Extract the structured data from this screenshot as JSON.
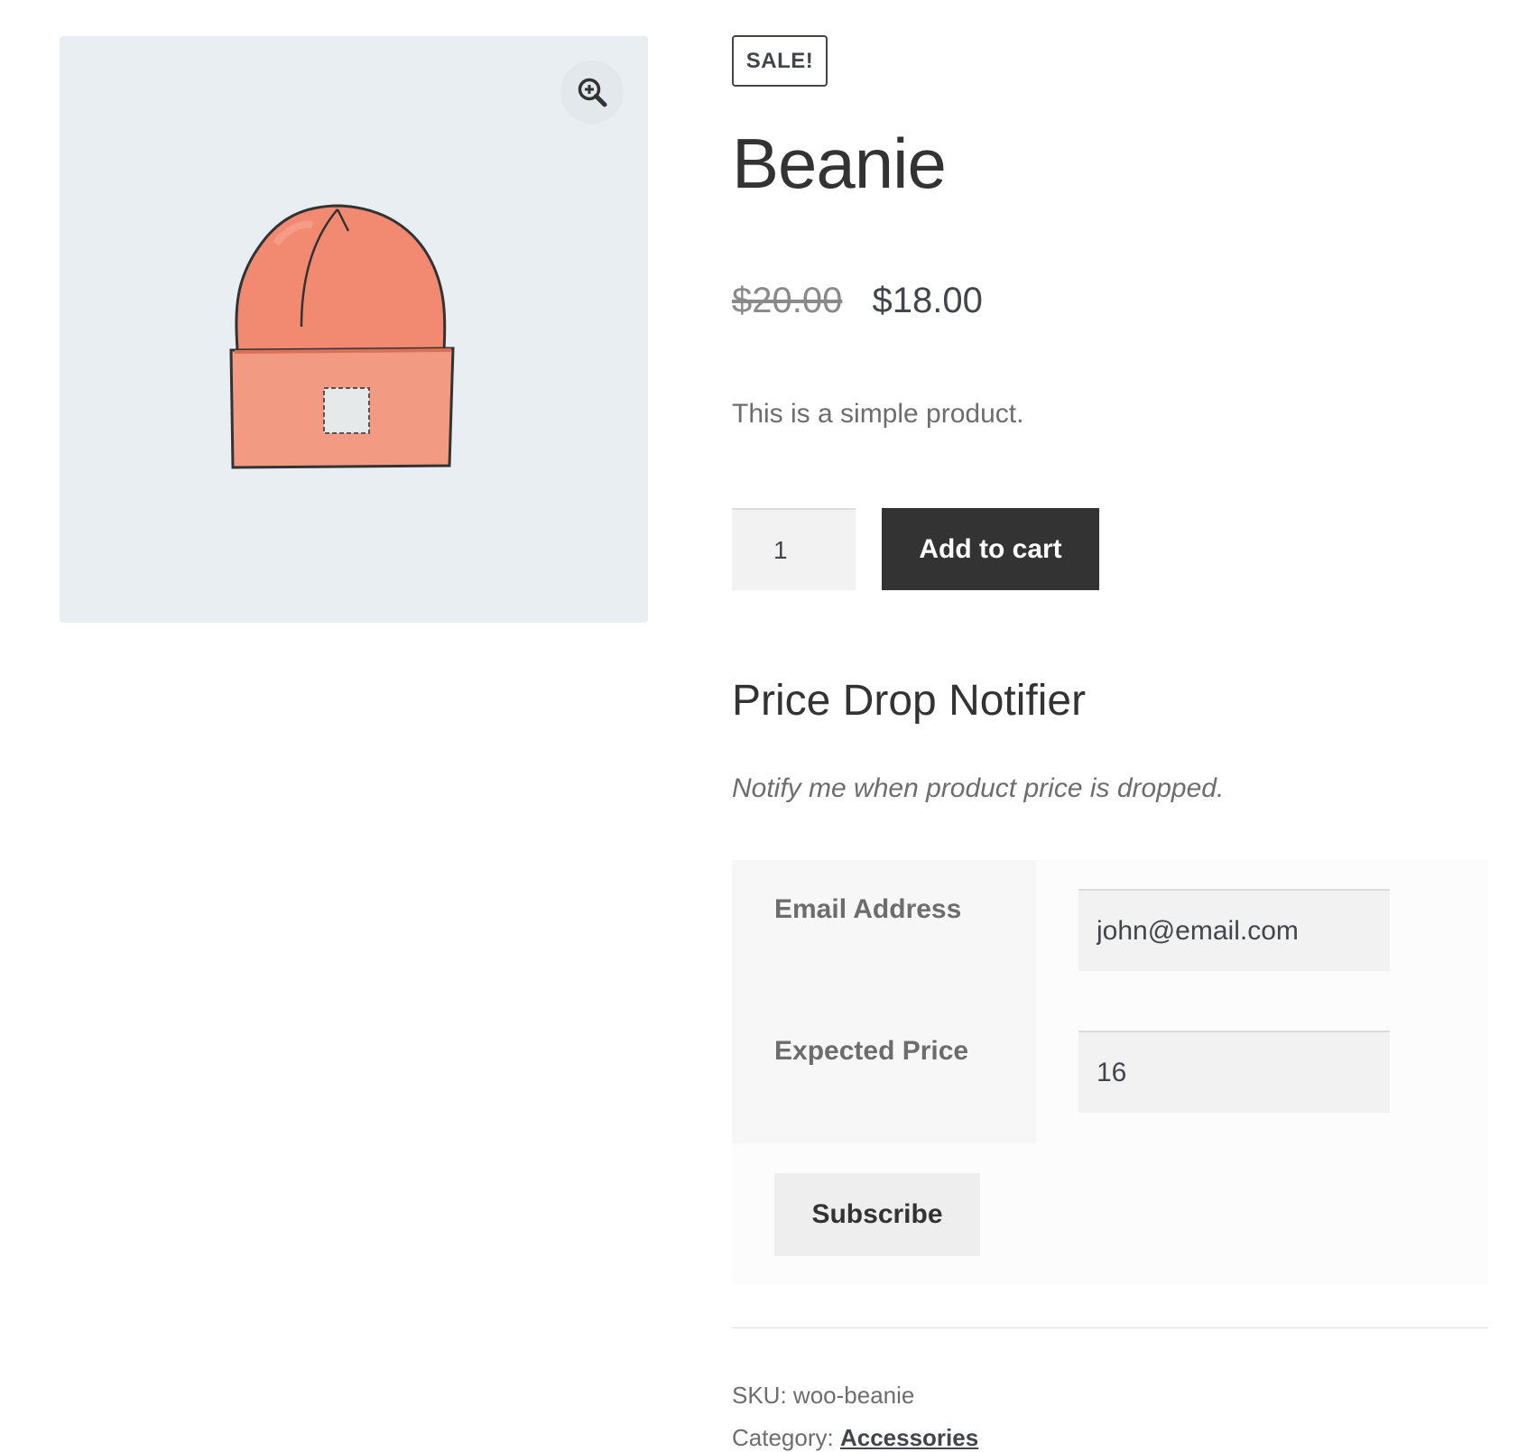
{
  "gallery": {
    "zoom_icon": "zoom-in-icon",
    "image_alt": "Beanie"
  },
  "product": {
    "badge": "SALE!",
    "title": "Beanie",
    "old_price": "$20.00",
    "new_price": "$18.00",
    "description": "This is a simple product.",
    "quantity": "1",
    "add_to_cart_label": "Add to cart"
  },
  "price_drop": {
    "title": "Price Drop Notifier",
    "subtitle": "Notify me when product price is dropped.",
    "email_label": "Email Address",
    "email_value": "john@email.com",
    "price_label": "Expected Price",
    "price_value": "16",
    "subscribe_label": "Subscribe"
  },
  "meta": {
    "sku_label": "SKU:",
    "sku_value": "woo-beanie",
    "category_label": "Category:",
    "category_value": "Accessories"
  },
  "colors": {
    "button_dark": "#333333",
    "image_bg": "#e9eef2",
    "beanie": "#f28a72"
  }
}
